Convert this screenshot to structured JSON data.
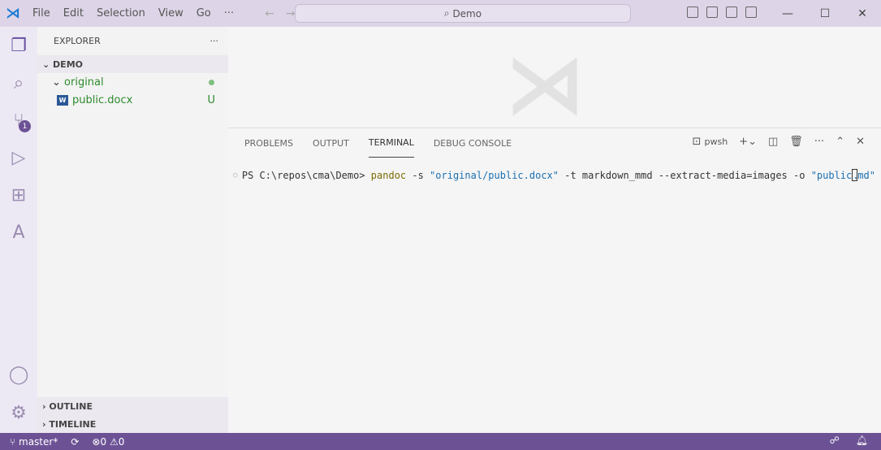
{
  "titlebar": {
    "menu": [
      "File",
      "Edit",
      "Selection",
      "View",
      "Go",
      "···"
    ],
    "search": "Demo"
  },
  "sidebar": {
    "title": "EXPLORER",
    "more": "···",
    "root": "DEMO",
    "folder": "original",
    "file": "public.docx",
    "file_status": "U",
    "outline": "OUTLINE",
    "timeline": "TIMELINE"
  },
  "activity": {
    "scm_badge": "1"
  },
  "panel": {
    "tabs": [
      "PROBLEMS",
      "OUTPUT",
      "TERMINAL",
      "DEBUG CONSOLE"
    ],
    "active_tab": "TERMINAL",
    "shell": "pwsh"
  },
  "terminal": {
    "prompt": "PS C:\\repos\\cma\\Demo> ",
    "cmd": "pandoc",
    "a1": " -s ",
    "s1": "\"original/public.docx\"",
    "a2": " -t markdown_mmd --extract-media=images -o ",
    "s2a": "\"public",
    "s2b": "md\""
  },
  "status": {
    "branch": "master*",
    "errors": "0",
    "warnings": "0"
  },
  "colors": {
    "accent": "#6c5295",
    "titlebar": "#ddd5e7"
  }
}
